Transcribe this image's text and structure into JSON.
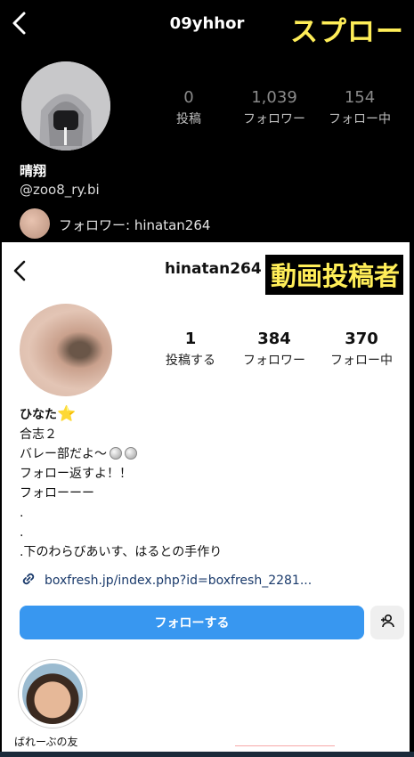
{
  "top_profile": {
    "username": "09yhhor",
    "tag": "スプロー",
    "stats": [
      {
        "value": "0",
        "label": "投稿"
      },
      {
        "value": "1,039",
        "label": "フォロワー"
      },
      {
        "value": "154",
        "label": "フォロー中"
      }
    ],
    "display_name": "晴翔",
    "handle": "@zoo8_ry.bi",
    "mutual": "フォロワー: hinatan264"
  },
  "bottom_profile": {
    "username": "hinatan264",
    "tag": "動画投稿者",
    "stats": [
      {
        "value": "1",
        "label": "投稿する"
      },
      {
        "value": "384",
        "label": "フォロワー"
      },
      {
        "value": "370",
        "label": "フォロー中"
      }
    ],
    "bio": {
      "name": "ひなた",
      "lines": [
        "合志２",
        "バレー部だよ〜",
        "フォロー返すよ！！",
        "フォローーー",
        ".",
        ".",
        ".下のわらびあいす、はるとの手作り"
      ]
    },
    "link": "boxfresh.jp/index.php?id=boxfresh_2281...",
    "follow_label": "フォローする",
    "highlight_label": "ばれーぶの友"
  },
  "icons": {
    "back": "chevron-left-icon",
    "link": "link-icon",
    "add_person": "person-add-icon"
  },
  "colors": {
    "follow_blue": "#3897f0",
    "tag_yellow": "#ffee58"
  }
}
